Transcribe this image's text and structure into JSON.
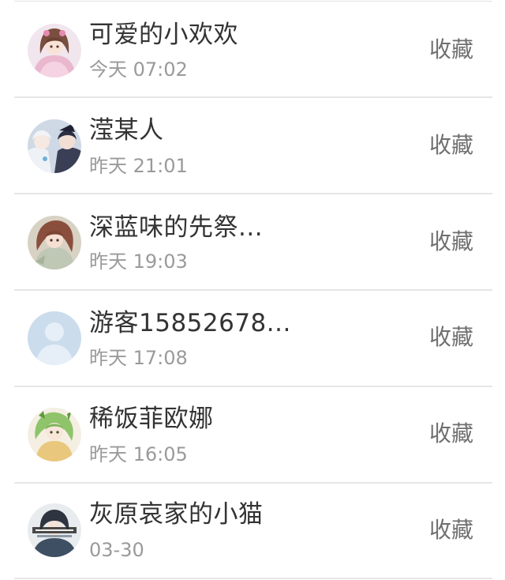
{
  "favorites_list": {
    "items": [
      {
        "name": "可爱的小欢欢",
        "time": "今天 07:02",
        "action": "收藏",
        "avatar_icon": "anime-girl-pink-dress-avatar"
      },
      {
        "name": "滢某人",
        "time": "昨天 21:01",
        "action": "收藏",
        "avatar_icon": "anime-couple-avatar"
      },
      {
        "name": "深蓝味的先祭...",
        "time": "昨天 19:03",
        "action": "收藏",
        "avatar_icon": "anime-girl-brown-hair-avatar"
      },
      {
        "name": "游客15852678...",
        "time": "昨天 17:08",
        "action": "收藏",
        "avatar_icon": "default-user-avatar"
      },
      {
        "name": "稀饭菲欧娜",
        "time": "昨天 16:05",
        "action": "收藏",
        "avatar_icon": "anime-girl-green-hair-avatar"
      },
      {
        "name": "灰原哀家的小猫",
        "time": "03-30",
        "action": "收藏",
        "avatar_icon": "anime-character-text-avatar"
      }
    ]
  },
  "colors": {
    "name_text": "#333333",
    "time_text": "#9a9a9a",
    "action_text": "#6f6f6f",
    "divider": "#e6e6e6",
    "background": "#ffffff"
  }
}
